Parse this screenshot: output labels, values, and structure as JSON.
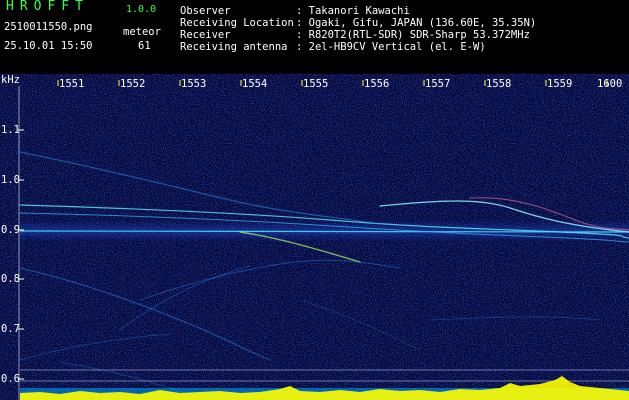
{
  "header": {
    "logo": "HROFFT",
    "version": "1.0.0",
    "filename": "2510011550.png",
    "datetime": "25.10.01 15:50",
    "meteor_label": "meteor",
    "meteor_count": "61",
    "fields": [
      {
        "label": "Observer",
        "value": ": Takanori Kawachi"
      },
      {
        "label": "Receiving Location",
        "value": ": Ogaki, Gifu, JAPAN (136.60E, 35.35N)"
      },
      {
        "label": "Receiver",
        "value": ": R820T2(RTL-SDR) SDR-Sharp 53.372MHz"
      },
      {
        "label": "Receiving antenna",
        "value": ": 2el-HB9CV Vertical (el. E-W)"
      }
    ]
  },
  "spectrogram": {
    "y_unit": "kHz",
    "y_ticks": [
      "1.1",
      "1.0",
      "0.9",
      "0.8",
      "0.7",
      "0.6"
    ],
    "time_ticks": [
      "1551",
      "1552",
      "1553",
      "1554",
      "1555",
      "1556",
      "1557",
      "1558",
      "1559",
      "1600"
    ]
  },
  "colors": {
    "header_green": "#33ff44",
    "axis_yellow": "#ffff33",
    "background_blue": "#03083a",
    "signal_cyan": "#5fe8ff",
    "noise_yellow": "#ffff00"
  }
}
